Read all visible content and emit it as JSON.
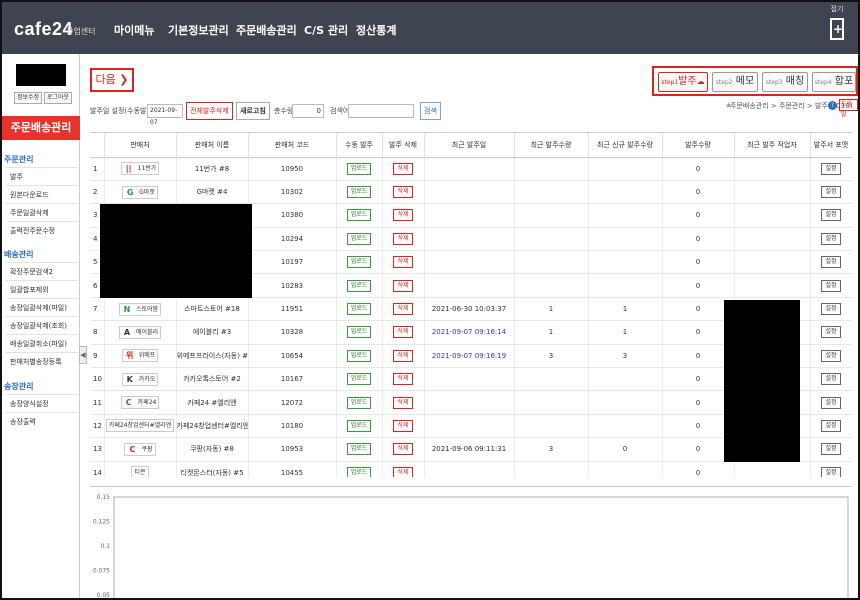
{
  "topnav": {
    "logo": "cafe24",
    "logo_sub": "창업센터",
    "items": [
      "마이메뉴",
      "기본정보관리",
      "주문배송관리",
      "C/S 관리",
      "정산통계"
    ],
    "help_label": "접기"
  },
  "sidebar": {
    "btn_info": "정보수정",
    "btn_logout": "로그아웃",
    "title": "주문배송관리",
    "sections": [
      {
        "title": "주문관리",
        "items": [
          "발주",
          "원본다운로드",
          "주문일괄삭제",
          "출력전주문수정"
        ]
      },
      {
        "title": "배송관리",
        "items": [
          "확장주문검색2",
          "일괄합포제외",
          "송장일괄삭제(파일)",
          "송장일괄삭제(조회)",
          "배송일괄취소(파일)",
          "판매처별송장등록"
        ]
      },
      {
        "title": "송장관리",
        "items": [
          "송장양식설정",
          "송장출력"
        ]
      }
    ]
  },
  "controls": {
    "next_label": "다음",
    "steps": [
      {
        "small": "step1",
        "label": "발주"
      },
      {
        "small": "step2",
        "label": "메모"
      },
      {
        "small": "step3",
        "label": "매칭"
      },
      {
        "small": "step4",
        "label": "합포"
      }
    ],
    "filter_date_label": "발주일 설정(수동발주)",
    "filter_date_value": "2021-09-07",
    "btn_delete_all": "전체발주삭제",
    "btn_refresh": "새로고침",
    "qty_label": "총수량",
    "qty_value": "0",
    "search_label": "검색어",
    "search_value": "",
    "btn_search": "검색",
    "breadcrumb": "주문배송관리 > 주문관리 > 발주(DC10)",
    "help_btn": "도움말"
  },
  "table": {
    "headers": [
      "",
      "판매처",
      "판매처 이름",
      "판매처 코드",
      "수동 발주",
      "발주 삭제",
      "최근 발주일",
      "최근 발주수량",
      "최근 신규 발주수량",
      "발주수량",
      "최근 발주 작업자",
      "발주서 포맷"
    ],
    "upload_label": "업로드",
    "delete_label": "삭제",
    "setting_label": "설정",
    "rows": [
      {
        "no": "1",
        "logo": "11번가",
        "mark": "||",
        "mark_color": "#d9251d",
        "name": "11번가 #8",
        "code": "10950",
        "date": "",
        "date_blue": false,
        "recent_qty": "",
        "new_qty": "",
        "qty": "0"
      },
      {
        "no": "2",
        "logo": "G마켓",
        "mark": "G",
        "mark_color": "#2a9a3a",
        "name": "G마켓 #4",
        "code": "10302",
        "date": "",
        "date_blue": false,
        "recent_qty": "",
        "new_qty": "",
        "qty": "0"
      },
      {
        "no": "3",
        "logo": "",
        "mark": "",
        "mark_color": "#000",
        "name": "",
        "code": "10380",
        "date": "",
        "date_blue": false,
        "recent_qty": "",
        "new_qty": "",
        "qty": "0"
      },
      {
        "no": "4",
        "logo": "",
        "mark": "",
        "mark_color": "#000",
        "name": "",
        "code": "10294",
        "date": "",
        "date_blue": false,
        "recent_qty": "",
        "new_qty": "",
        "qty": "0"
      },
      {
        "no": "5",
        "logo": "",
        "mark": "",
        "mark_color": "#000",
        "name": "",
        "code": "10197",
        "date": "",
        "date_blue": false,
        "recent_qty": "",
        "new_qty": "",
        "qty": "0"
      },
      {
        "no": "6",
        "logo": "",
        "mark": "",
        "mark_color": "#000",
        "name": "",
        "code": "10283",
        "date": "",
        "date_blue": false,
        "recent_qty": "",
        "new_qty": "",
        "qty": "0"
      },
      {
        "no": "7",
        "logo": "스토어팜",
        "mark": "N",
        "mark_color": "#2a9a3a",
        "name": "스마트스토어 #18",
        "code": "11951",
        "date": "2021-06-30 10:03:37",
        "date_blue": false,
        "recent_qty": "1",
        "new_qty": "1",
        "qty": "0"
      },
      {
        "no": "8",
        "logo": "에이블리",
        "mark": "A",
        "mark_color": "#333",
        "name": "에이블리 #3",
        "code": "10328",
        "date": "2021-09-07 09:16:14",
        "date_blue": true,
        "recent_qty": "1",
        "new_qty": "1",
        "qty": "0"
      },
      {
        "no": "9",
        "logo": "위메프",
        "mark": "위",
        "mark_color": "#d9251d",
        "name": "위메프프라이스(자동) #7",
        "code": "10654",
        "date": "2021-09-07 09:16:19",
        "date_blue": true,
        "recent_qty": "3",
        "new_qty": "3",
        "qty": "0"
      },
      {
        "no": "10",
        "logo": "카카오",
        "mark": "K",
        "mark_color": "#333",
        "name": "카카오톡스토어 #2",
        "code": "10167",
        "date": "",
        "date_blue": false,
        "recent_qty": "",
        "new_qty": "",
        "qty": "0"
      },
      {
        "no": "11",
        "logo": "카페24",
        "mark": "C",
        "mark_color": "#2b6cc4",
        "name": "카페24 #엘리엔",
        "code": "12072",
        "date": "",
        "date_blue": false,
        "recent_qty": "",
        "new_qty": "",
        "qty": "0"
      },
      {
        "no": "12",
        "logo": "카페24창업센터#엘리엔",
        "mark": "",
        "mark_color": "#333",
        "name": "카페24창업센터#엘리엔",
        "code": "10180",
        "date": "",
        "date_blue": false,
        "recent_qty": "",
        "new_qty": "",
        "qty": "0"
      },
      {
        "no": "13",
        "logo": "쿠팡",
        "mark": "C",
        "mark_color": "#d9251d",
        "name": "쿠팡(자동) #8",
        "code": "10953",
        "date": "2021-09-06 09:11:31",
        "date_blue": false,
        "recent_qty": "3",
        "new_qty": "0",
        "qty": "0"
      },
      {
        "no": "14",
        "logo": "티몬",
        "mark": "",
        "mark_color": "#d9251d",
        "name": "티켓몬스터(자동) #5",
        "code": "10455",
        "date": "",
        "date_blue": false,
        "recent_qty": "",
        "new_qty": "",
        "qty": "0"
      }
    ]
  },
  "chart": {
    "ticks": [
      "0.15",
      "0.125",
      "0.1",
      "0.075",
      "0.05"
    ]
  }
}
